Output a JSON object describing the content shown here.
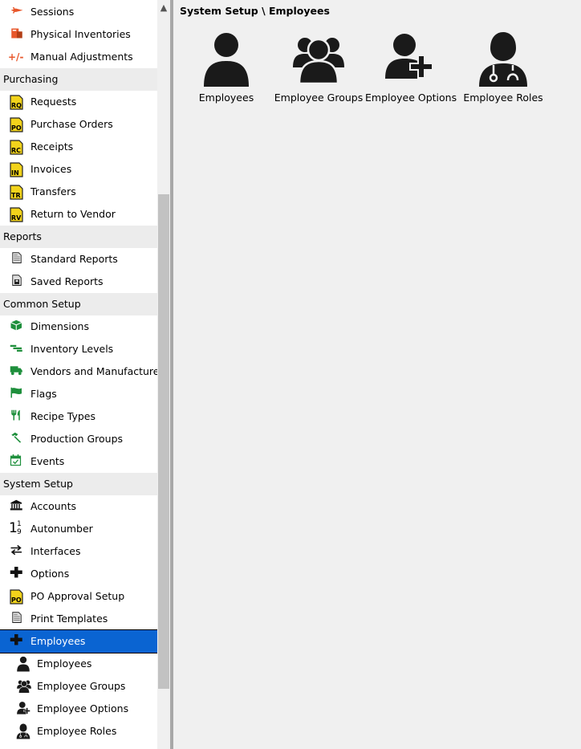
{
  "breadcrumb": "System Setup \\ Employees",
  "sidebar": {
    "items": [
      {
        "label": "Sessions",
        "icon": "sessions-icon",
        "kind": "item"
      },
      {
        "label": "Physical Inventories",
        "icon": "physical-inventories-icon",
        "kind": "item"
      },
      {
        "label": "Manual Adjustments",
        "icon": "manual-adjustments-icon",
        "icon_text": "+/-",
        "kind": "item"
      },
      {
        "label": "Purchasing",
        "kind": "section"
      },
      {
        "label": "Requests",
        "icon": "doc-code-icon",
        "code": "RQ",
        "kind": "item"
      },
      {
        "label": "Purchase Orders",
        "icon": "doc-code-icon",
        "code": "PO",
        "kind": "item"
      },
      {
        "label": "Receipts",
        "icon": "doc-code-icon",
        "code": "RC",
        "kind": "item"
      },
      {
        "label": "Invoices",
        "icon": "doc-code-icon",
        "code": "IN",
        "kind": "item"
      },
      {
        "label": "Transfers",
        "icon": "doc-code-icon",
        "code": "TR",
        "kind": "item"
      },
      {
        "label": "Return to Vendor",
        "icon": "doc-code-icon",
        "code": "RV",
        "kind": "item"
      },
      {
        "label": "Reports",
        "kind": "section"
      },
      {
        "label": "Standard Reports",
        "icon": "report-icon",
        "kind": "item"
      },
      {
        "label": "Saved Reports",
        "icon": "saved-report-icon",
        "kind": "item"
      },
      {
        "label": "Common Setup",
        "kind": "section"
      },
      {
        "label": "Dimensions",
        "icon": "cube-icon",
        "kind": "item"
      },
      {
        "label": "Inventory Levels",
        "icon": "inventory-levels-icon",
        "kind": "item"
      },
      {
        "label": "Vendors and Manufacturers",
        "icon": "truck-icon",
        "kind": "item"
      },
      {
        "label": "Flags",
        "icon": "flag-icon",
        "kind": "item"
      },
      {
        "label": "Recipe Types",
        "icon": "utensils-icon",
        "kind": "item"
      },
      {
        "label": "Production Groups",
        "icon": "hammer-icon",
        "kind": "item"
      },
      {
        "label": "Events",
        "icon": "calendar-check-icon",
        "kind": "item"
      },
      {
        "label": "System Setup",
        "kind": "section"
      },
      {
        "label": "Accounts",
        "icon": "bank-icon",
        "kind": "item"
      },
      {
        "label": "Autonumber",
        "icon": "sort-numeric-icon",
        "icon_text": "1",
        "icon_text2": "9",
        "kind": "item"
      },
      {
        "label": "Interfaces",
        "icon": "exchange-icon",
        "kind": "item"
      },
      {
        "label": "Options",
        "icon": "plus-icon",
        "kind": "item"
      },
      {
        "label": "PO Approval Setup",
        "icon": "doc-code-icon",
        "code": "PO",
        "kind": "item"
      },
      {
        "label": "Print Templates",
        "icon": "report-icon",
        "kind": "item"
      },
      {
        "label": "Employees",
        "icon": "plus-icon",
        "kind": "item",
        "selected": true
      },
      {
        "label": "Employees",
        "icon": "user-icon",
        "kind": "sub"
      },
      {
        "label": "Employee Groups",
        "icon": "users-icon",
        "kind": "sub"
      },
      {
        "label": "Employee Options",
        "icon": "user-plus-icon",
        "kind": "sub"
      },
      {
        "label": "Employee Roles",
        "icon": "user-doctor-icon",
        "kind": "sub"
      }
    ]
  },
  "tiles": [
    {
      "label": "Employees",
      "icon": "user-icon"
    },
    {
      "label": "Employee Groups",
      "icon": "users-icon"
    },
    {
      "label": "Employee Options",
      "icon": "user-plus-icon"
    },
    {
      "label": "Employee Roles",
      "icon": "user-doctor-icon"
    }
  ],
  "colors": {
    "selected_bg": "#0a64d2",
    "section_bg": "#ececec",
    "doc_yellow": "#f2d31b",
    "orange": "#e8572b",
    "green": "#1e8f3c"
  }
}
